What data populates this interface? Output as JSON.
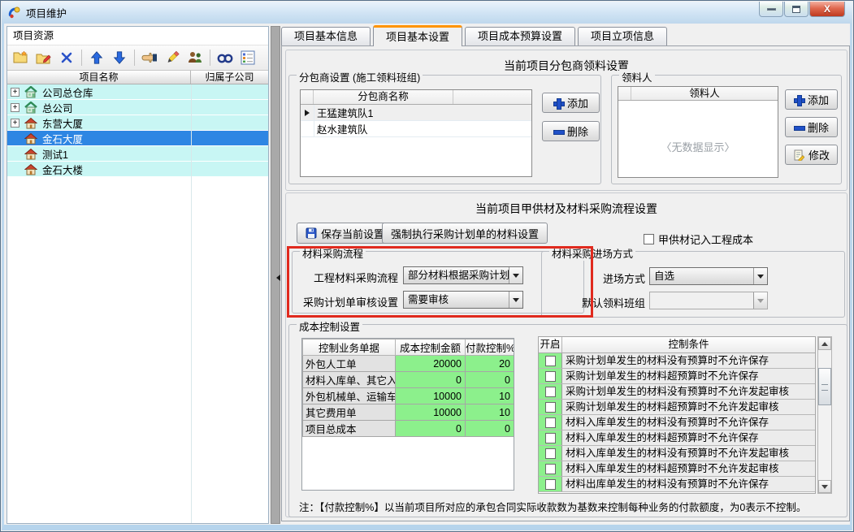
{
  "window": {
    "title": "项目维护",
    "control_icons": [
      "minimize-icon",
      "restore-icon",
      "close-icon"
    ]
  },
  "left_panel": {
    "caption": "项目资源",
    "toolbar_icons": [
      "add-folder-icon",
      "edit-folder-icon",
      "delete-icon",
      "move-up-icon",
      "move-down-icon",
      "select-hand-icon",
      "edit-pencil-icon",
      "users-icon",
      "find-icon",
      "view-detail-icon"
    ],
    "tree": {
      "columns": {
        "name": "项目名称",
        "company": "归属子公司"
      },
      "items": [
        {
          "label": "公司总仓库",
          "expandable": true,
          "green": true,
          "selected": false
        },
        {
          "label": "总公司",
          "expandable": true,
          "green": true,
          "selected": false
        },
        {
          "label": "东营大厦",
          "expandable": true,
          "green": false,
          "selected": false
        },
        {
          "label": "金石大厦",
          "expandable": false,
          "green": false,
          "selected": true
        },
        {
          "label": "测试1",
          "expandable": false,
          "green": false,
          "selected": false
        },
        {
          "label": "金石大楼",
          "expandable": false,
          "green": false,
          "selected": false
        }
      ]
    }
  },
  "tabs": [
    {
      "label": "项目基本信息",
      "active": false
    },
    {
      "label": "项目基本设置",
      "active": true
    },
    {
      "label": "项目成本预算设置",
      "active": false
    },
    {
      "label": "项目立项信息",
      "active": false
    }
  ],
  "subcontractor_section": {
    "title": "当前项目分包商领料设置",
    "group_label": "分包商设置 (施工领料班组)",
    "column": "分包商名称",
    "rows": [
      {
        "name": "王猛建筑队1",
        "current": true
      },
      {
        "name": "赵水建筑队",
        "current": false
      }
    ],
    "add_label": "添加",
    "delete_label": "删除"
  },
  "picker_section": {
    "group_label": "领料人",
    "column": "领料人",
    "empty_text": "〈无数据显示〉",
    "add_label": "添加",
    "delete_label": "删除",
    "modify_label": "修改"
  },
  "procurement_section": {
    "title": "当前项目甲供材及材料采购流程设置",
    "save_button": "保存当前设置",
    "force_button": "强制执行采购计划单的材料设置",
    "checkbox_label": "甲供材记入工程成本",
    "checkbox_checked": false,
    "flow_group": {
      "label": "材料采购流程",
      "field1_label": "工程材料采购流程",
      "field1_value": "部分材料根据采购计划",
      "field2_label": "采购计划单审核设置",
      "field2_value": "需要审核"
    },
    "entry_group": {
      "label": "材料采购进场方式",
      "field1_label": "进场方式",
      "field1_value": "自选",
      "field2_label": "默认领料班组",
      "field2_value": ""
    }
  },
  "cost_control": {
    "group_label": "成本控制设置",
    "columns": {
      "doc": "控制业务单据",
      "amount": "成本控制金额",
      "percent": "付款控制%"
    },
    "rows": [
      {
        "name": "外包人工单",
        "amount": "20000",
        "percent": "20"
      },
      {
        "name": "材料入库单、其它入库单",
        "amount": "0",
        "percent": "0"
      },
      {
        "name": "外包机械单、运输车单",
        "amount": "10000",
        "percent": "10"
      },
      {
        "name": "其它费用单",
        "amount": "10000",
        "percent": "10"
      },
      {
        "name": "项目总成本",
        "amount": "0",
        "percent": "0"
      }
    ]
  },
  "conditions": {
    "columns": {
      "enabled": "开启",
      "condition": "控制条件"
    },
    "rows": [
      {
        "text": "采购计划单发生的材料没有预算时不允许保存",
        "checked": false
      },
      {
        "text": "采购计划单发生的材料超预算时不允许保存",
        "checked": false
      },
      {
        "text": "采购计划单发生的材料没有预算时不允许发起审核",
        "checked": false
      },
      {
        "text": "采购计划单发生的材料超预算时不允许发起审核",
        "checked": false
      },
      {
        "text": "材料入库单发生的材料没有预算时不允许保存",
        "checked": false
      },
      {
        "text": "材料入库单发生的材料超预算时不允许保存",
        "checked": false
      },
      {
        "text": "材料入库单发生的材料没有预算时不允许发起审核",
        "checked": false
      },
      {
        "text": "材料入库单发生的材料超预算时不允许发起审核",
        "checked": false
      },
      {
        "text": "材料出库单发生的材料没有预算时不允许保存",
        "checked": false
      }
    ]
  },
  "note": "注：【付款控制%】以当前项目所对应的承包合同实际收款数为基数来控制每种业务的付款额度，为0表示不控制。",
  "colors": {
    "accent_tab": "#ff9400",
    "highlight_row": "#2e86e3",
    "cell_green": "#8cf08c",
    "row_cyan": "#c8f6f4",
    "alert_outline": "#e02a1e"
  }
}
